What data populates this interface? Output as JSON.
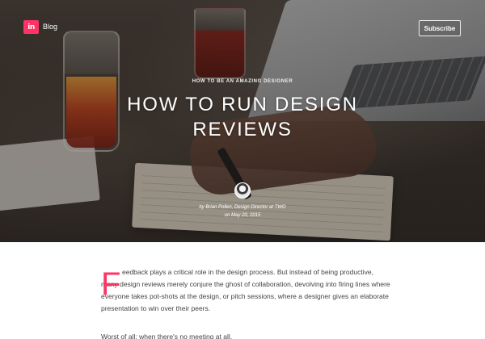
{
  "header": {
    "logo_text": "in",
    "blog_label": "Blog",
    "subscribe_label": "Subscribe",
    "brand_color": "#ff3366"
  },
  "hero": {
    "eyebrow": "HOW TO BE AN AMAZING DESIGNER",
    "title": "How to Run Design Reviews",
    "byline_author": "by Brian Pollen, Design Director at TWG",
    "byline_date": "on May 20, 2015"
  },
  "article": {
    "dropcap": "F",
    "lead_line1": "eedback plays a critical role in the design process. But instead of being productive,",
    "lead_rest": "many design reviews merely conjure the ghost of collaboration, devolving into firing lines where everyone takes pot-shots at the design, or pitch sessions, where a designer gives an elaborate presentation to win over their peers.",
    "para2": "Worst of all: when there's no meeting at all."
  }
}
